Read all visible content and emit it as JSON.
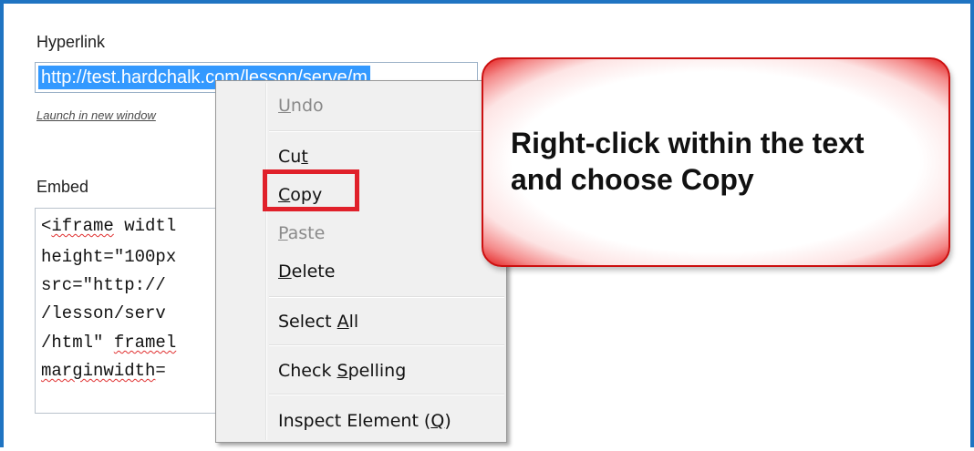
{
  "hyperlink": {
    "label": "Hyperlink",
    "value": "http://test.hardchalk.com/lesson/serve/m",
    "launch_link": "Launch in new window"
  },
  "embed": {
    "label": "Embed",
    "lines": [
      {
        "pre": "<",
        "sq": "iframe",
        "post": " widtl"
      },
      {
        "pre": "height=\"100px",
        "sq": "",
        "post": ""
      },
      {
        "pre": "src=\"http://",
        "sq": "",
        "post": ""
      },
      {
        "pre": "/lesson/serv",
        "sq": "",
        "post": ""
      },
      {
        "pre": "/html\" ",
        "sq": "framel",
        "post": ""
      },
      {
        "pre": "",
        "sq": "marginwidth",
        "post": "="
      }
    ]
  },
  "context_menu": {
    "items": [
      {
        "label": "Undo",
        "mnemonic_index": 0,
        "disabled": true
      },
      {
        "label": "Cut",
        "mnemonic_index": 2,
        "disabled": false
      },
      {
        "label": "Copy",
        "mnemonic_index": 0,
        "disabled": false
      },
      {
        "label": "Paste",
        "mnemonic_index": 0,
        "disabled": true
      },
      {
        "label": "Delete",
        "mnemonic_index": 0,
        "disabled": false
      },
      {
        "label": "Select All",
        "mnemonic_index": 7,
        "disabled": false
      },
      {
        "label": "Check Spelling",
        "mnemonic_index": 6,
        "disabled": false
      },
      {
        "label": "Inspect Element (Q)",
        "mnemonic_index": 17,
        "disabled": false
      }
    ]
  },
  "callout": {
    "text_line1": "Right-click within the text",
    "text_line2": "and choose Copy"
  },
  "colors": {
    "frame_border": "#1f74c2",
    "selection": "#3399ff",
    "highlight_box": "#e0202a",
    "callout_edge": "#e31c1c"
  }
}
